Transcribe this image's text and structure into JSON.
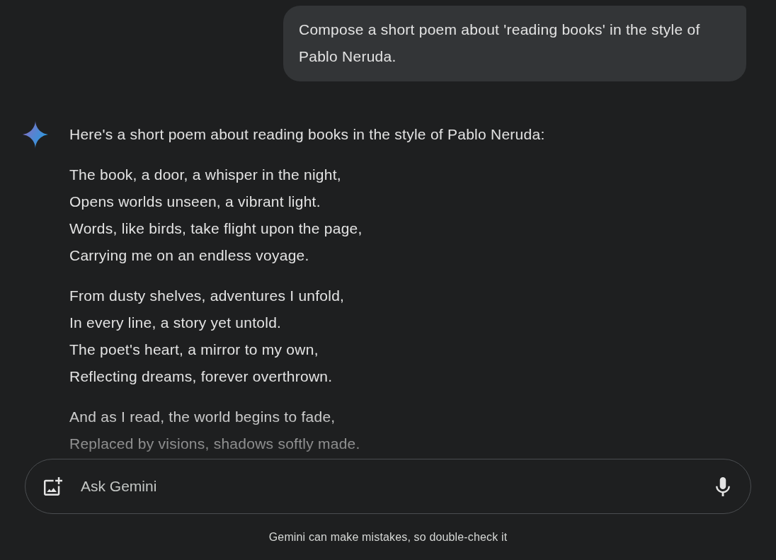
{
  "conversation": {
    "user_message": {
      "text": "Compose a short poem about 'reading books' in the style of Pablo Neruda."
    },
    "response": {
      "intro": "Here's a short poem about reading books in the style of Pablo Neruda:",
      "stanzas": [
        {
          "lines": [
            "The book, a door, a whisper in the night,",
            "Opens worlds unseen, a vibrant light.",
            "Words, like birds, take flight upon the page,",
            "Carrying me on an endless voyage."
          ]
        },
        {
          "lines": [
            "From dusty shelves, adventures I unfold,",
            "In every line, a story yet untold.",
            "The poet's heart, a mirror to my own,",
            "Reflecting dreams, forever overthrown."
          ]
        },
        {
          "lines": [
            "And as I read, the world begins to fade,",
            "Replaced by visions, shadows softly made."
          ]
        }
      ]
    }
  },
  "input": {
    "placeholder": "Ask Gemini"
  },
  "disclaimer": "Gemini can make mistakes, so double-check it"
}
